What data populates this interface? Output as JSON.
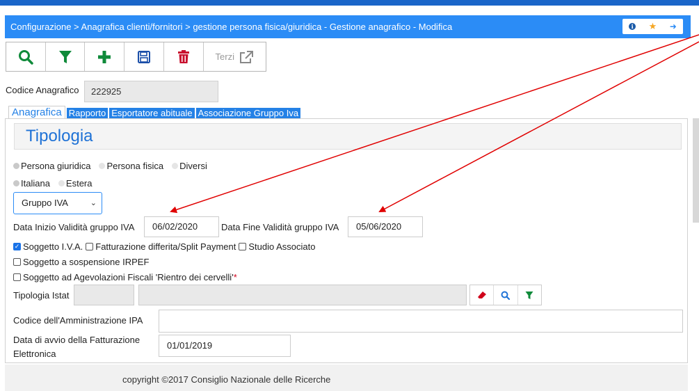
{
  "header": {
    "breadcrumb": "Configurazione > Anagrafica clienti/fornitori > gestione persona fisica/giuridica - Gestione anagrafico - Modifica"
  },
  "toolbar": {
    "terzi_label": "Terzi",
    "colors": {
      "search": "#0f8a3a",
      "filter": "#0f8a3a",
      "add": "#0f8a3a",
      "save": "#1a4ea8",
      "delete": "#c8102e"
    }
  },
  "codice": {
    "label": "Codice Anagrafico",
    "value": "222925"
  },
  "tabs": [
    {
      "label": "Anagrafica",
      "active": true
    },
    {
      "label": "Rapporto",
      "active": false
    },
    {
      "label": "Esportatore abituale",
      "active": false
    },
    {
      "label": "Associazione Gruppo Iva",
      "active": false
    }
  ],
  "section": {
    "title": "Tipologia"
  },
  "persona_radios": [
    {
      "label": "Persona giuridica",
      "selected": true
    },
    {
      "label": "Persona fisica",
      "selected": false
    },
    {
      "label": "Diversi",
      "selected": false
    }
  ],
  "nazionalita_radios": [
    {
      "label": "Italiana",
      "selected": true
    },
    {
      "label": "Estera",
      "selected": false
    }
  ],
  "tipo_select": {
    "value": "Gruppo IVA"
  },
  "gruppo_iva": {
    "start_label": "Data Inizio Validità gruppo IVA",
    "start_value": "06/02/2020",
    "end_label": "Data Fine Validità gruppo IVA",
    "end_value": "05/06/2020"
  },
  "checkboxes": {
    "soggetto_iva": {
      "label": "Soggetto I.V.A.",
      "checked": true
    },
    "split_payment": {
      "label": "Fatturazione differita/Split Payment",
      "checked": false
    },
    "studio_associato": {
      "label": "Studio Associato",
      "checked": false
    },
    "sospensione_irpef": {
      "label": "Soggetto a sospensione IRPEF",
      "checked": false
    },
    "agevolazioni": {
      "label": "Soggetto ad Agevolazioni Fiscali 'Rientro dei cervelli'",
      "required_mark": "*",
      "checked": false
    }
  },
  "istat": {
    "label": "Tipologia Istat",
    "code": "",
    "description": ""
  },
  "ipa": {
    "label": "Codice dell'Amministrazione IPA",
    "value": ""
  },
  "fatturazione": {
    "label_line1": "Data di avvio della Fatturazione",
    "label_line2": "Elettronica",
    "value": "01/01/2019"
  },
  "footer": {
    "copyright": "copyright ©2017 Consiglio Nazionale delle Ricerche"
  },
  "annotation_color": "#e00000"
}
